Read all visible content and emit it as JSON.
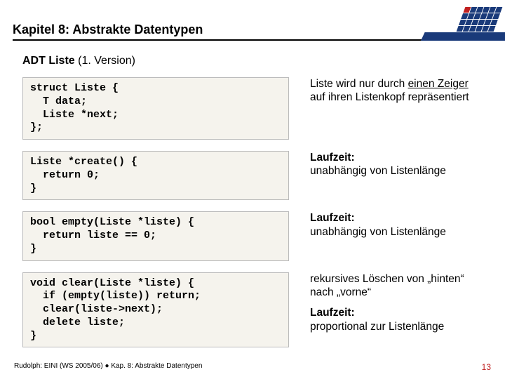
{
  "header": {
    "chapter_title": "Kapitel 8: Abstrakte Datentypen"
  },
  "subtitle_prefix": "ADT Liste ",
  "subtitle_suffix": "(1. Version)",
  "rows": [
    {
      "code": "struct Liste {\n  T data;\n  Liste *next;\n};",
      "desc_html": "Liste wird nur durch <span class=\"underline\">einen Zeiger</span> auf ihren Listenkopf repräsentiert"
    },
    {
      "code": "Liste *create() {\n  return 0;\n}",
      "desc_html": "<b>Laufzeit:</b><br>unabhängig von Listenlänge"
    },
    {
      "code": "bool empty(Liste *liste) {\n  return liste == 0;\n}",
      "desc_html": "<b>Laufzeit:</b><br>unabhängig von Listenlänge"
    },
    {
      "code": "void clear(Liste *liste) {\n  if (empty(liste)) return;\n  clear(liste->next);\n  delete liste;\n}",
      "desc_html": "<p>rekursives Löschen von „hinten“ nach „vorne“</p><p><b>Laufzeit:</b><br>proportional zur Listenlänge</p>"
    }
  ],
  "footer": {
    "left": "Rudolph: EINI (WS 2005/06)  ●  Kap. 8: Abstrakte Datentypen",
    "page": "13"
  }
}
